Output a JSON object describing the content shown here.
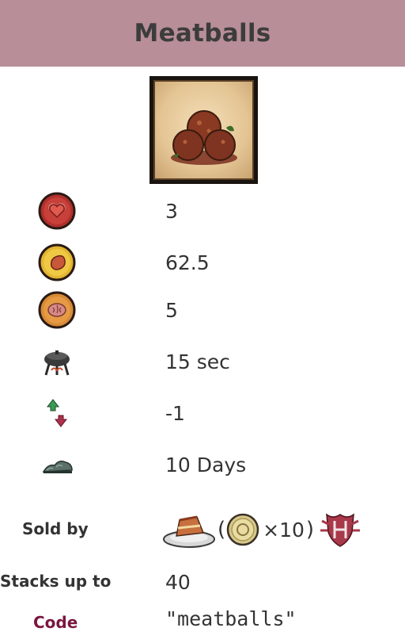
{
  "title": "Meatballs",
  "image_icon": "meatballs-food-icon",
  "stats": [
    {
      "icon": "health-heart-icon",
      "value": "3"
    },
    {
      "icon": "hunger-stomach-icon",
      "value": "62.5"
    },
    {
      "icon": "sanity-brain-icon",
      "value": "5"
    },
    {
      "icon": "crock-pot-icon",
      "value": "15 sec"
    },
    {
      "icon": "priority-arrows-icon",
      "value": "-1"
    },
    {
      "icon": "spoil-time-icon",
      "value": "10 Days"
    }
  ],
  "sold_by": {
    "label": "Sold by",
    "vendor_icon": "cake-platter-icon",
    "open_paren": "(",
    "currency_icon": "oinc-coin-icon",
    "quantity": "×10",
    "close_paren": ")",
    "extra_icon": "hamlet-shield-icon"
  },
  "stacks": {
    "label": "Stacks up to",
    "value": "40"
  },
  "code": {
    "label": "Code",
    "value": "\"meatballs\""
  }
}
